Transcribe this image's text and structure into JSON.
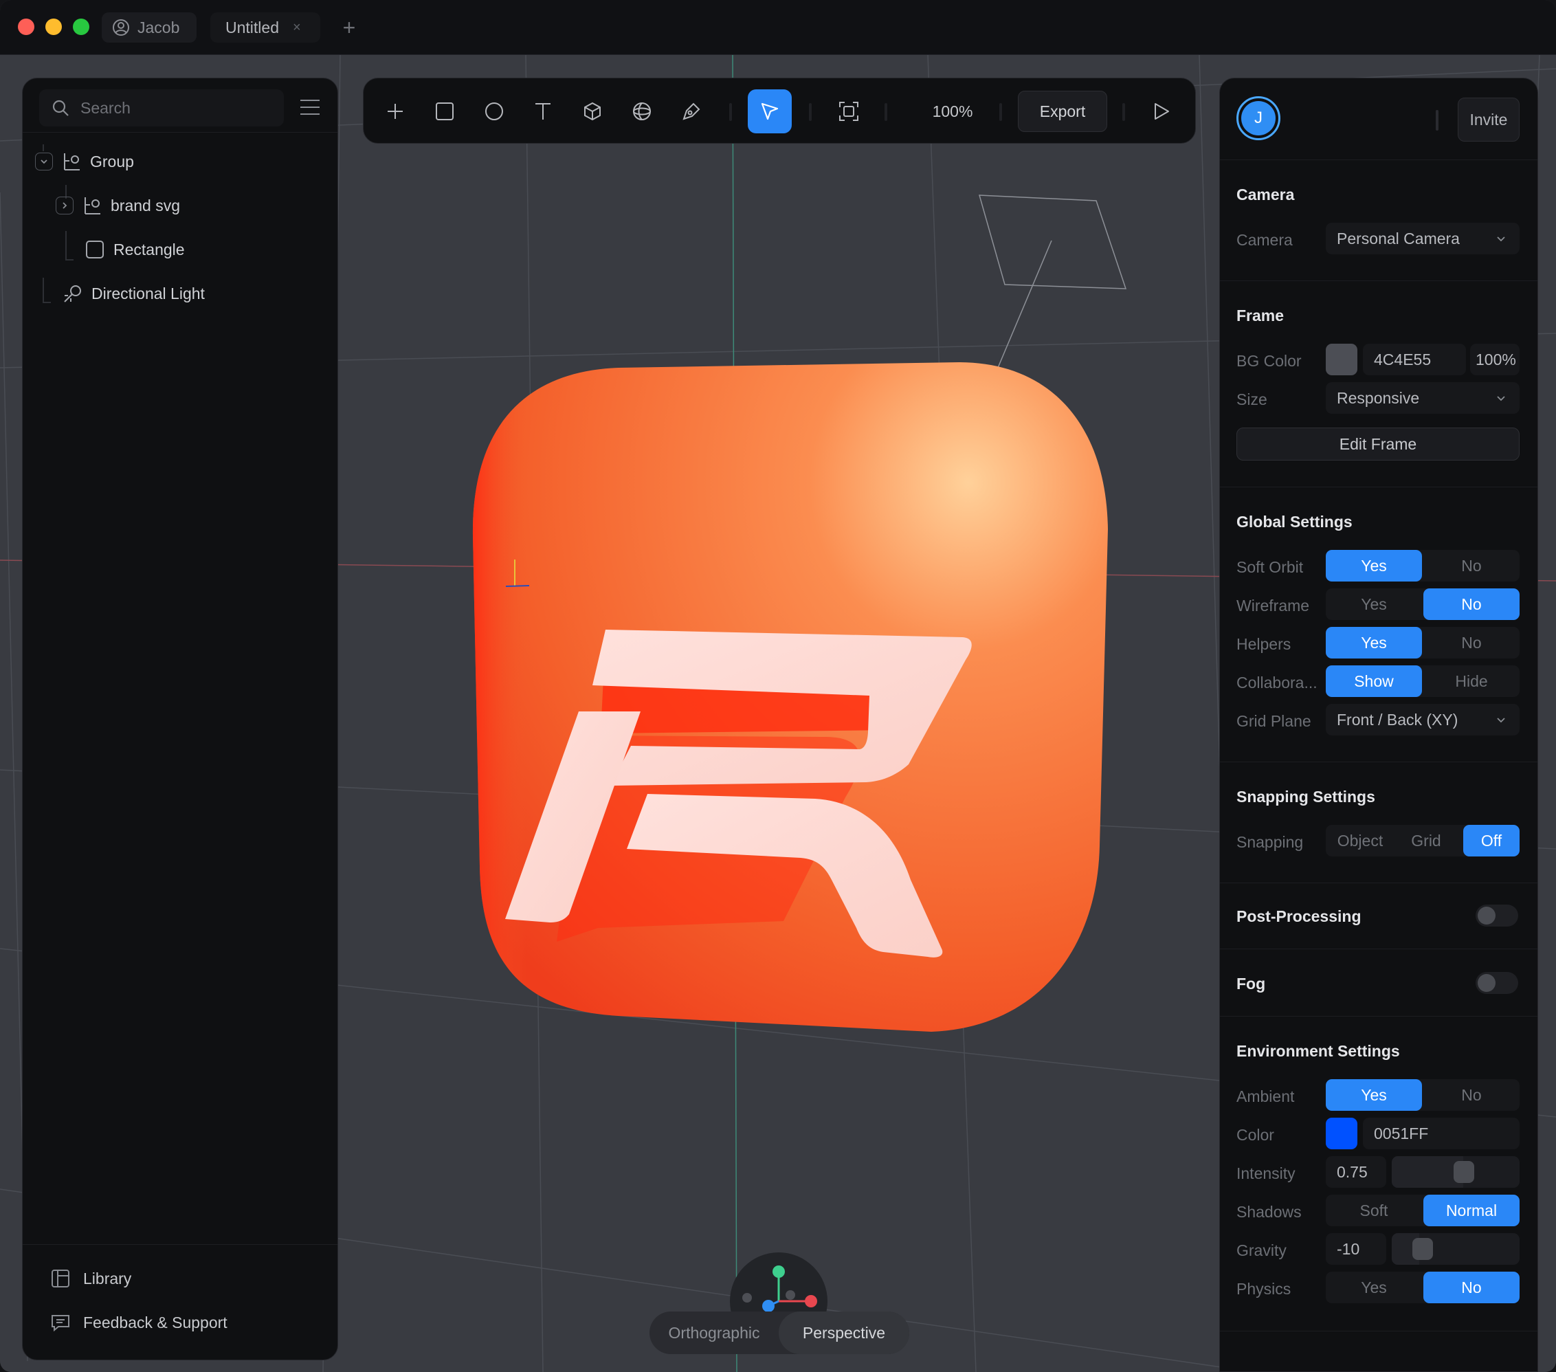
{
  "titlebar": {
    "user_name": "Jacob",
    "tab_title": "Untitled",
    "tab_close": "×",
    "add_tab": "+"
  },
  "left_panel": {
    "search_placeholder": "Search",
    "tree": [
      {
        "label": "Group",
        "icon": "group-icon",
        "expanded": true
      },
      {
        "label": "brand svg",
        "icon": "group-icon",
        "expanded": false
      },
      {
        "label": "Rectangle",
        "icon": "rectangle-icon"
      },
      {
        "label": "Directional Light",
        "icon": "light-icon"
      }
    ],
    "library_label": "Library",
    "feedback_label": "Feedback & Support"
  },
  "toolbar": {
    "tools": [
      "plus-icon",
      "rectangle-icon",
      "circle-icon",
      "text-icon",
      "cube-icon",
      "sphere-icon",
      "pen-icon",
      "select-icon",
      "frame-icon"
    ],
    "active_tool": "select-icon",
    "zoom": "100%",
    "export_label": "Export",
    "play": "play-icon"
  },
  "right_panel": {
    "avatar_initial": "J",
    "invite_label": "Invite",
    "camera": {
      "title": "Camera",
      "label": "Camera",
      "value": "Personal Camera"
    },
    "frame": {
      "title": "Frame",
      "bg_label": "BG Color",
      "bg_hex": "4C4E55",
      "bg_color": "#4C4E55",
      "bg_opacity": "100%",
      "size_label": "Size",
      "size_value": "Responsive",
      "edit_label": "Edit Frame"
    },
    "global": {
      "title": "Global Settings",
      "soft_orbit": {
        "label": "Soft Orbit",
        "a": "Yes",
        "b": "No",
        "selected": "Yes"
      },
      "wireframe": {
        "label": "Wireframe",
        "a": "Yes",
        "b": "No",
        "selected": "No"
      },
      "helpers": {
        "label": "Helpers",
        "a": "Yes",
        "b": "No",
        "selected": "Yes"
      },
      "collab": {
        "label": "Collabora...",
        "a": "Show",
        "b": "Hide",
        "selected": "Show"
      },
      "grid_plane": {
        "label": "Grid Plane",
        "value": "Front / Back (XY)"
      }
    },
    "snapping": {
      "title": "Snapping Settings",
      "label": "Snapping",
      "options": [
        "Object",
        "Grid",
        "Off"
      ],
      "selected": "Off"
    },
    "post_processing": {
      "title": "Post-Processing",
      "enabled": false
    },
    "fog": {
      "title": "Fog",
      "enabled": false
    },
    "environment": {
      "title": "Environment Settings",
      "ambient": {
        "label": "Ambient",
        "a": "Yes",
        "b": "No",
        "selected": "Yes"
      },
      "color": {
        "label": "Color",
        "hex": "0051FF",
        "value": "#0051FF"
      },
      "intensity": {
        "label": "Intensity",
        "value": "0.75"
      },
      "shadows": {
        "label": "Shadows",
        "a": "Soft",
        "b": "Normal",
        "selected": "Normal"
      },
      "gravity": {
        "label": "Gravity",
        "value": "-10"
      },
      "physics": {
        "label": "Physics",
        "a": "Yes",
        "b": "No",
        "selected": "No"
      }
    }
  },
  "viewport": {
    "view_modes": [
      "Orthographic",
      "Perspective"
    ],
    "selected_view": "Perspective",
    "accent_orange": "#F4602B",
    "axis_colors": {
      "x": "#E8474F",
      "y": "#3ECF8E",
      "z": "#2F8EF4"
    }
  },
  "colors": {
    "accent": "#2A87F7",
    "panel": "#0F1012",
    "viewport_bg": "#393B41"
  }
}
